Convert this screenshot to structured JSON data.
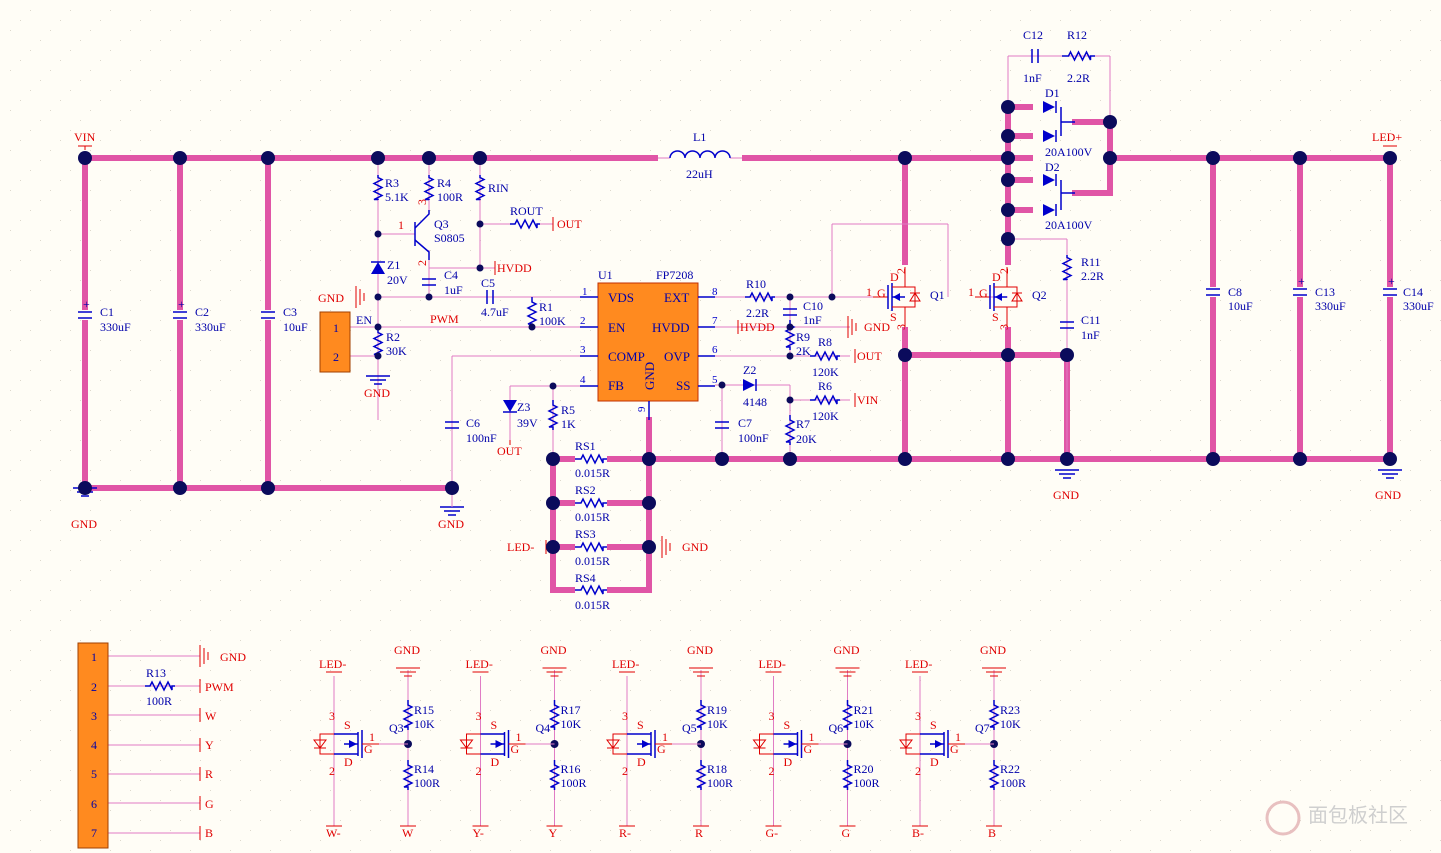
{
  "colors": {
    "bus": "#e055a6",
    "wire": "#e07cc4",
    "component": "#0000cc",
    "net_label": "#e00000",
    "junction": "#0b0b5c",
    "ic_fill": "#ff8a1f",
    "background": "#fffdf6"
  },
  "nets": {
    "vin": "VIN",
    "gnd": "GND",
    "led_plus": "LED+",
    "led_minus": "LED-",
    "out": "OUT",
    "hvdd": "HVDD",
    "pwm": "PWM",
    "en": "EN",
    "w": "W",
    "y": "Y",
    "r": "R",
    "g": "G",
    "b": "B",
    "w_minus": "W-",
    "y_minus": "Y-",
    "r_minus": "R-",
    "g_minus": "G-",
    "b_minus": "B-"
  },
  "components": {
    "c1": {
      "ref": "C1",
      "value": "330uF"
    },
    "c2": {
      "ref": "C2",
      "value": "330uF"
    },
    "c3": {
      "ref": "C3",
      "value": "10uF"
    },
    "r3": {
      "ref": "R3",
      "value": "5.1K"
    },
    "r4": {
      "ref": "R4",
      "value": "100R"
    },
    "rin": {
      "ref": "RIN"
    },
    "rout": {
      "ref": "ROUT"
    },
    "q3top": {
      "ref": "Q3",
      "value": "S0805"
    },
    "z1": {
      "ref": "Z1",
      "value": "20V"
    },
    "c4": {
      "ref": "C4",
      "value": "1uF"
    },
    "c5": {
      "ref": "C5",
      "value": "4.7uF"
    },
    "r1": {
      "ref": "R1",
      "value": "100K"
    },
    "r2": {
      "ref": "R2",
      "value": "30K"
    },
    "u1": {
      "ref": "U1",
      "value": "FP7208",
      "pins": {
        "vds": "VDS",
        "en": "EN",
        "comp": "COMP",
        "fb": "FB",
        "ext": "EXT",
        "hvdd": "HVDD",
        "ovp": "OVP",
        "ss": "SS",
        "gnd": "GND"
      }
    },
    "l1": {
      "ref": "L1",
      "value": "22uH"
    },
    "r10": {
      "ref": "R10",
      "value": "2.2R"
    },
    "c10": {
      "ref": "C10",
      "value": "1nF"
    },
    "r9": {
      "ref": "R9",
      "value": "2K"
    },
    "r8": {
      "ref": "R8",
      "value": "120K"
    },
    "z2": {
      "ref": "Z2",
      "value": "4148"
    },
    "r6": {
      "ref": "R6",
      "value": "120K"
    },
    "c7": {
      "ref": "C7",
      "value": "100nF"
    },
    "r7": {
      "ref": "R7",
      "value": "20K"
    },
    "c6": {
      "ref": "C6",
      "value": "100nF"
    },
    "z3": {
      "ref": "Z3",
      "value": "39V"
    },
    "r5": {
      "ref": "R5",
      "value": "1K"
    },
    "rs1": {
      "ref": "RS1",
      "value": "0.015R"
    },
    "rs2": {
      "ref": "RS2",
      "value": "0.015R"
    },
    "rs3": {
      "ref": "RS3",
      "value": "0.015R"
    },
    "rs4": {
      "ref": "RS4",
      "value": "0.015R"
    },
    "q1": {
      "ref": "Q1"
    },
    "q2": {
      "ref": "Q2"
    },
    "c12": {
      "ref": "C12",
      "value": "1nF"
    },
    "r12": {
      "ref": "R12",
      "value": "2.2R"
    },
    "d1": {
      "ref": "D1",
      "value": "20A100V"
    },
    "d2": {
      "ref": "D2",
      "value": "20A100V"
    },
    "r11": {
      "ref": "R11",
      "value": "2.2R"
    },
    "c11": {
      "ref": "C11",
      "value": "1nF"
    },
    "c8": {
      "ref": "C8",
      "value": "10uF"
    },
    "c13": {
      "ref": "C13",
      "value": "330uF"
    },
    "c14": {
      "ref": "C14",
      "value": "330uF"
    },
    "r13": {
      "ref": "R13",
      "value": "100R"
    }
  },
  "channels": [
    {
      "q": "Q3",
      "rt": "R15",
      "rtv": "10K",
      "rb": "R14",
      "rbv": "100R",
      "drain": "W-",
      "ctrl": "W"
    },
    {
      "q": "Q4",
      "rt": "R17",
      "rtv": "10K",
      "rb": "R16",
      "rbv": "100R",
      "drain": "Y-",
      "ctrl": "Y"
    },
    {
      "q": "Q5",
      "rt": "R19",
      "rtv": "10K",
      "rb": "R18",
      "rbv": "100R",
      "drain": "R-",
      "ctrl": "R"
    },
    {
      "q": "Q6",
      "rt": "R21",
      "rtv": "10K",
      "rb": "R20",
      "rbv": "100R",
      "drain": "G-",
      "ctrl": "G"
    },
    {
      "q": "Q7",
      "rt": "R23",
      "rtv": "10K",
      "rb": "R22",
      "rbv": "100R",
      "drain": "B-",
      "ctrl": "B"
    }
  ],
  "pin_numbers": {
    "p1": "1",
    "p2": "2",
    "p3": "3",
    "p4": "4",
    "p5": "5",
    "p6": "6",
    "p7": "7",
    "p8": "8",
    "p9": "9",
    "g": "G",
    "d": "D",
    "s": "S"
  },
  "watermark": "面包板社区"
}
